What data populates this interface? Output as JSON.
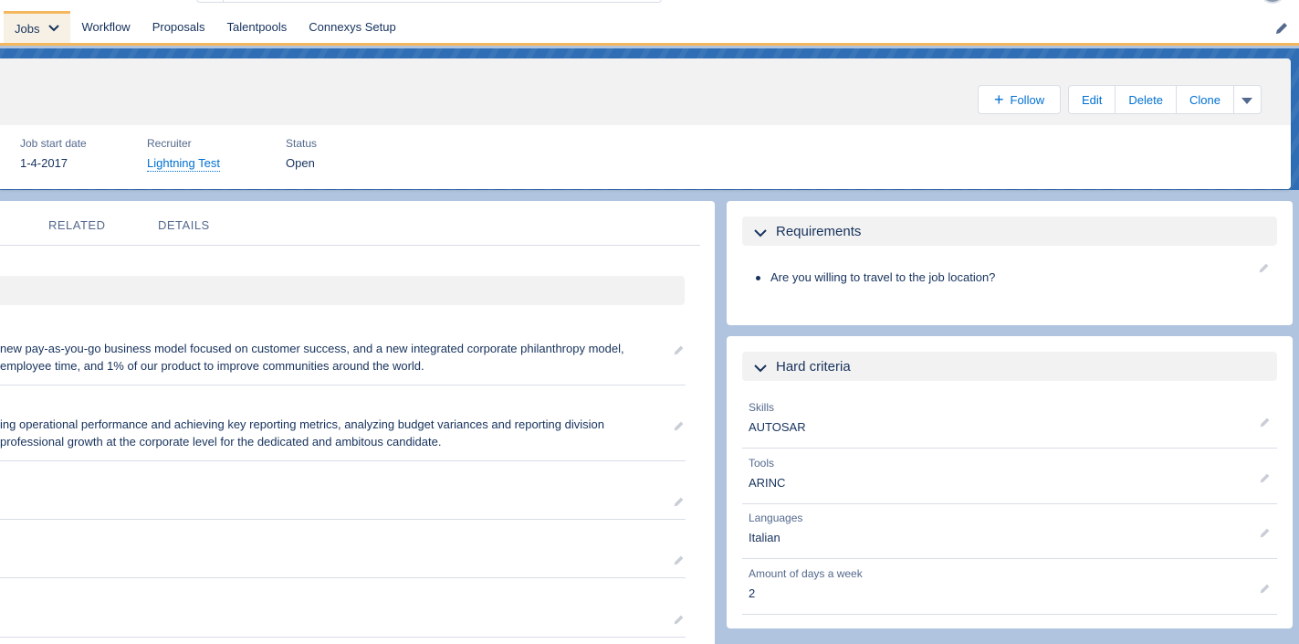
{
  "nav": {
    "tabs": [
      {
        "label": "Jobs"
      },
      {
        "label": "Workflow"
      },
      {
        "label": "Proposals"
      },
      {
        "label": "Talentpools"
      },
      {
        "label": "Connexys Setup"
      }
    ]
  },
  "header": {
    "follow_label": "Follow",
    "actions": [
      "Edit",
      "Delete",
      "Clone"
    ],
    "fields": [
      {
        "label": "Job start date",
        "value": "1-4-2017"
      },
      {
        "label": "Recruiter",
        "value": "Lightning Test"
      },
      {
        "label": "Status",
        "value": "Open"
      }
    ]
  },
  "main": {
    "tabs": [
      "RELATED",
      "DETAILS"
    ],
    "rows": [
      {
        "lines": [
          "new pay-as-you-go business model focused on customer success, and a new integrated corporate philanthropy model,",
          "employee time, and 1% of our product to improve communities around the world."
        ]
      },
      {
        "lines": [
          "ing operational performance and achieving key reporting metrics, analyzing budget variances and reporting division",
          " professional growth at the corporate level for the dedicated and ambitous candidate."
        ]
      }
    ]
  },
  "requirements": {
    "title": "Requirements",
    "items": [
      "Are you willing to travel to the job location?"
    ]
  },
  "hard_criteria": {
    "title": "Hard criteria",
    "rows": [
      {
        "label": "Skills",
        "value": "AUTOSAR"
      },
      {
        "label": "Tools",
        "value": "ARINC"
      },
      {
        "label": "Languages",
        "value": "Italian"
      },
      {
        "label": "Amount of days a week",
        "value": "2"
      }
    ]
  },
  "colors": {
    "accent": "#f4b75e",
    "link": "#0070d2",
    "text": "#16325c",
    "label": "#54698d",
    "band": "#2f6db5"
  },
  "icons": {
    "tab_dropdown": "chevron-down-icon",
    "page_edit": "pencil-icon",
    "follow": "plus-icon",
    "more_actions": "caret-down-icon",
    "section_toggle": "chevron-down-icon",
    "inline_edit": "pencil-icon"
  }
}
